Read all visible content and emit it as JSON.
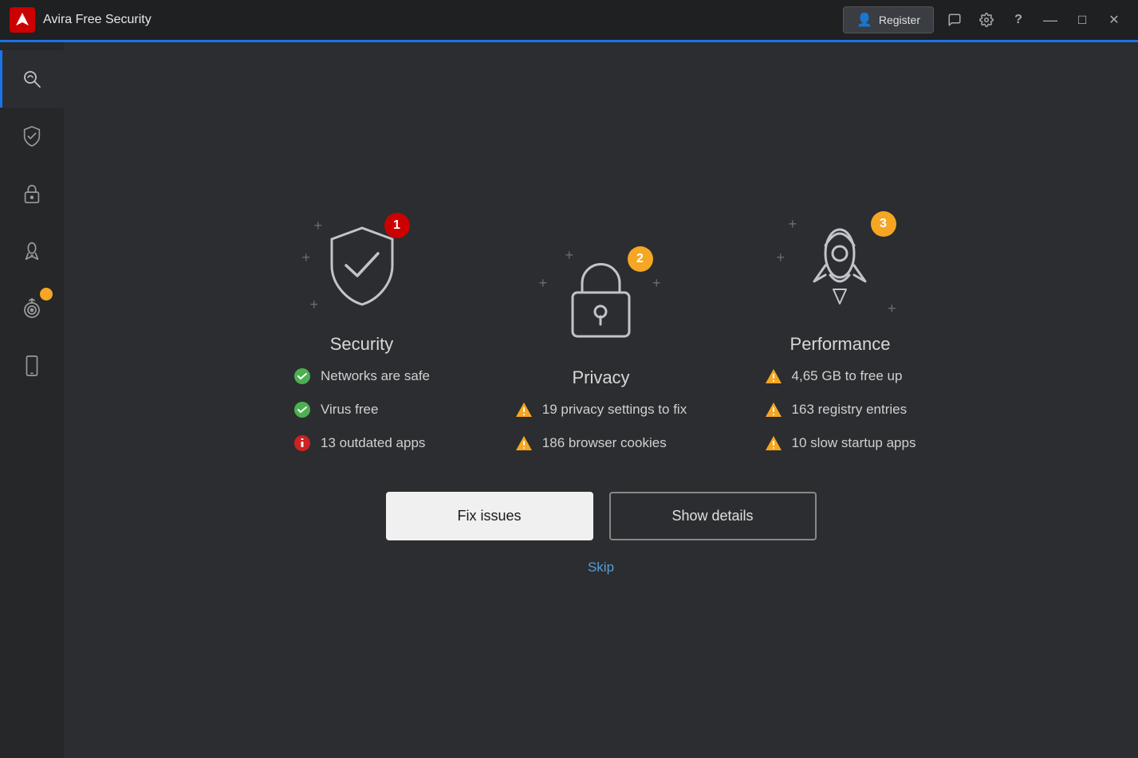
{
  "app": {
    "title": "Avira Free Security",
    "logo_text": "A"
  },
  "titlebar": {
    "register_label": "Register",
    "controls": {
      "message_icon": "💬",
      "settings_icon": "⚙",
      "help_icon": "?",
      "minimize_icon": "—",
      "maximize_icon": "☐",
      "close_icon": "✕"
    }
  },
  "sidebar": {
    "items": [
      {
        "name": "scan",
        "label": "Scan",
        "active": true
      },
      {
        "name": "security",
        "label": "Security",
        "active": false
      },
      {
        "name": "privacy",
        "label": "Privacy",
        "active": false
      },
      {
        "name": "performance",
        "label": "Performance",
        "active": false
      },
      {
        "name": "updates",
        "label": "Updates",
        "active": false
      },
      {
        "name": "mobile",
        "label": "Mobile",
        "active": false
      }
    ]
  },
  "categories": [
    {
      "id": "security",
      "name": "Security",
      "badge": "1",
      "badge_color": "red",
      "issues": [
        {
          "type": "ok",
          "text": "Networks are safe"
        },
        {
          "type": "ok",
          "text": "Virus free"
        },
        {
          "type": "error",
          "text": "13 outdated apps"
        }
      ]
    },
    {
      "id": "privacy",
      "name": "Privacy",
      "badge": "2",
      "badge_color": "orange",
      "issues": [
        {
          "type": "warning",
          "text": "19 privacy settings to fix"
        },
        {
          "type": "warning",
          "text": "186 browser cookies"
        }
      ]
    },
    {
      "id": "performance",
      "name": "Performance",
      "badge": "3",
      "badge_color": "orange",
      "issues": [
        {
          "type": "warning",
          "text": "4,65 GB to free up"
        },
        {
          "type": "warning",
          "text": "163 registry entries"
        },
        {
          "type": "warning",
          "text": "10 slow startup apps"
        }
      ]
    }
  ],
  "actions": {
    "fix_label": "Fix issues",
    "details_label": "Show details",
    "skip_label": "Skip"
  }
}
